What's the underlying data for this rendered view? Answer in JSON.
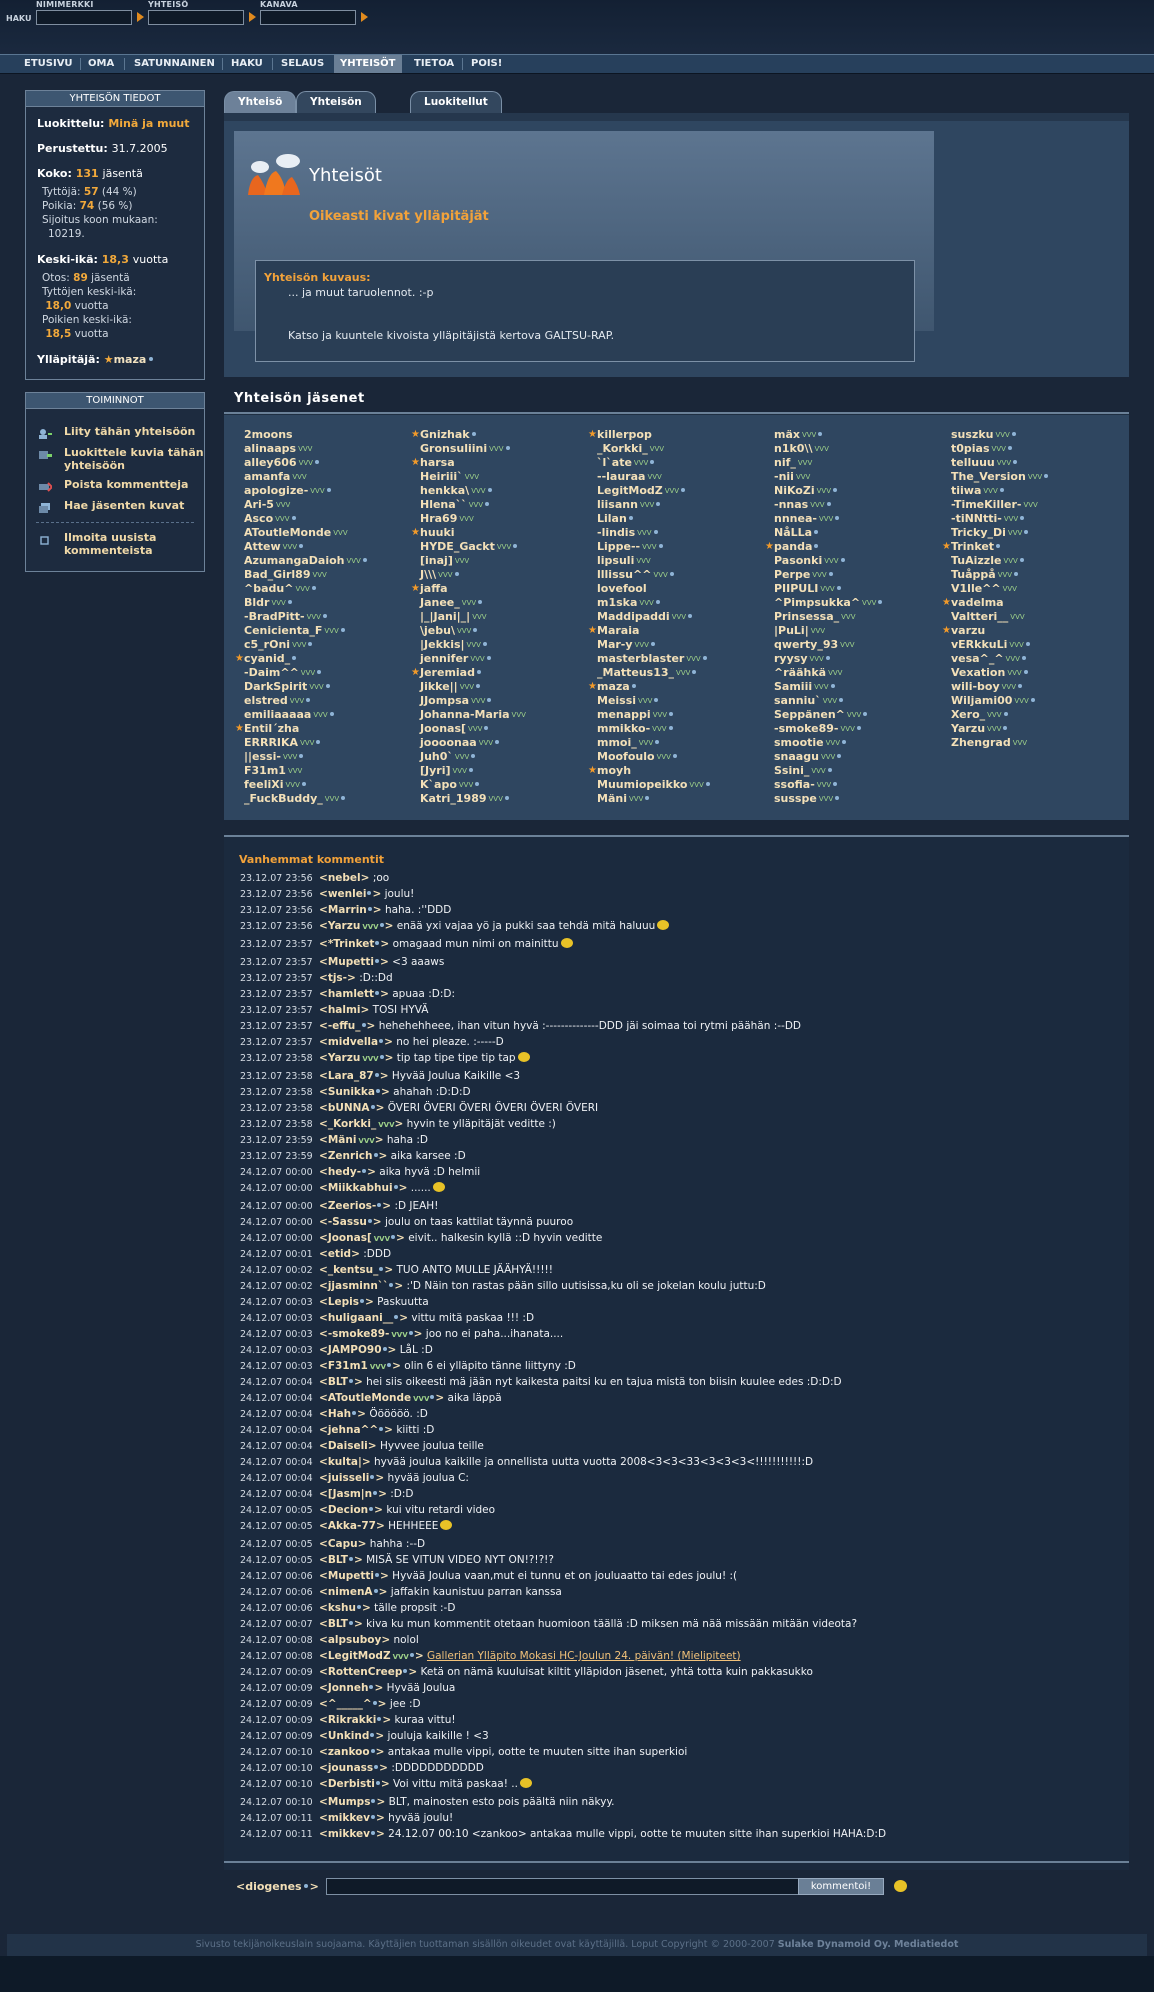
{
  "search": {
    "haku_label": "HAKU",
    "fields": [
      {
        "label": "NIMIMERKKI",
        "value": ""
      },
      {
        "label": "YHTEISÖ",
        "value": ""
      },
      {
        "label": "KANAVA",
        "value": ""
      }
    ]
  },
  "nav": {
    "items": [
      "ETUSIVU",
      "OMA",
      "SATUNNAINEN",
      "HAKU",
      "SELAUS",
      "YHTEISÖT",
      "TIETOA",
      "POIS!"
    ],
    "active": "YHTEISÖT"
  },
  "info": {
    "title": "YHTEISÖN TIEDOT",
    "category_label": "Luokittelu:",
    "category": "Minä ja muut",
    "founded_label": "Perustettu:",
    "founded": "31.7.2005",
    "size_label": "Koko:",
    "size": "131",
    "size_unit": "jäsentä",
    "girls_label": "Tyttöjä:",
    "girls": "57",
    "girls_pct": "(44 %)",
    "boys_label": "Poikia:",
    "boys": "74",
    "boys_pct": "(56 %)",
    "rank_label": "Sijoitus koon mukaan:",
    "rank": "10219.",
    "age_label": "Keski-ikä:",
    "age": "18,3",
    "age_unit": "vuotta",
    "sample_label": "Otos:",
    "sample": "89",
    "sample_unit": "jäsentä",
    "gavg_label": "Tyttöjen keski-ikä:",
    "gavg": "18,0",
    "gavg_unit": "vuotta",
    "bavg_label": "Poikien keski-ikä:",
    "bavg": "18,5",
    "bavg_unit": "vuotta",
    "admin_label": "Ylläpitäjä:",
    "admin": "maza"
  },
  "actions": {
    "title": "TOIMINNOT",
    "items": [
      {
        "label": "Liity tähän yhteisöön",
        "icon": "join-icon"
      },
      {
        "label": "Luokittele kuvia tähän yhteisöön",
        "icon": "categorize-icon"
      },
      {
        "label": "Poista kommentteja",
        "icon": "delete-comments-icon"
      },
      {
        "label": "Hae jäsenten kuvat",
        "icon": "member-photos-icon"
      },
      {
        "label": "Ilmoita uusista kommenteista",
        "icon": "notify-icon"
      }
    ]
  },
  "tabs": [
    "Yhteisö",
    "Yhteisön kuvat",
    "Luokitellut kuvat"
  ],
  "community": {
    "header": "Yhteisöt",
    "name": "Oikeasti kivat ylläpitäjät",
    "desc_title": "Yhteisön kuvaus:",
    "desc_line1": "... ja muut taruolennot. :-p",
    "desc_line2": "Katso ja kuuntele kivoista ylläpitäjistä kertova GALTSU-RAP."
  },
  "members_title": "Yhteisön jäsenet",
  "members": [
    [
      [
        "2moons",
        0,
        0,
        0
      ],
      [
        "alinaaps",
        0,
        1,
        0
      ],
      [
        "alley606",
        0,
        1,
        1
      ],
      [
        "amanfa",
        0,
        1,
        0
      ],
      [
        "apologize-",
        0,
        1,
        1
      ],
      [
        "Ari-5",
        0,
        1,
        0
      ],
      [
        "Asco",
        0,
        1,
        1
      ],
      [
        "AToutleMonde",
        0,
        1,
        0
      ],
      [
        "Attew",
        0,
        1,
        1
      ],
      [
        "AzumangaDaioh",
        0,
        1,
        1
      ],
      [
        "Bad_Girl89",
        0,
        1,
        0
      ],
      [
        "^badu^",
        0,
        1,
        1
      ],
      [
        "Bldr",
        0,
        1,
        1
      ],
      [
        "-BradPitt-",
        0,
        1,
        1
      ],
      [
        "Cenicienta_F",
        0,
        1,
        1
      ],
      [
        "c5_rOni",
        0,
        1,
        1
      ],
      [
        "cyanid_",
        1,
        0,
        1
      ],
      [
        "-Daim^^",
        0,
        1,
        1
      ],
      [
        "DarkSpirit",
        0,
        1,
        1
      ],
      [
        "elstred",
        0,
        1,
        1
      ],
      [
        "emiliaaaaa",
        0,
        1,
        1
      ],
      [
        "Entil´zha",
        1,
        0,
        0
      ],
      [
        "ERRRIKA",
        0,
        1,
        1
      ],
      [
        "||essi-",
        0,
        1,
        1
      ],
      [
        "F31m1",
        0,
        1,
        0
      ],
      [
        "feeliXi",
        0,
        1,
        1
      ],
      [
        "_FuckBuddy_",
        0,
        1,
        1
      ]
    ],
    [
      [
        "Gnizhak",
        1,
        0,
        1
      ],
      [
        "Gronsuliini",
        0,
        1,
        1
      ],
      [
        "harsa",
        1,
        0,
        0
      ],
      [
        "Heiriii`",
        0,
        1,
        0
      ],
      [
        "henkka\\",
        0,
        1,
        1
      ],
      [
        "Hlena``",
        0,
        1,
        1
      ],
      [
        "Hra69",
        0,
        1,
        0
      ],
      [
        "huuki",
        1,
        0,
        0
      ],
      [
        "HYDE_Gackt",
        0,
        1,
        1
      ],
      [
        "[inaj]",
        0,
        1,
        0
      ],
      [
        "J\\\\\\",
        0,
        1,
        1
      ],
      [
        "jaffa",
        1,
        0,
        0
      ],
      [
        "Janee_",
        0,
        1,
        1
      ],
      [
        "|_|Jani|_|",
        0,
        1,
        0
      ],
      [
        "\\jebu\\",
        0,
        1,
        1
      ],
      [
        "|Jekkis|",
        0,
        1,
        1
      ],
      [
        "jennifer",
        0,
        1,
        1
      ],
      [
        "Jeremiad",
        1,
        0,
        1
      ],
      [
        "Jikke||",
        0,
        1,
        1
      ],
      [
        "JJompsa",
        0,
        1,
        1
      ],
      [
        "Johanna-Maria",
        0,
        1,
        0
      ],
      [
        "Joonas[",
        0,
        1,
        1
      ],
      [
        "joooonaa",
        0,
        1,
        1
      ],
      [
        "Juh0`",
        0,
        1,
        1
      ],
      [
        "[Jyri]",
        0,
        1,
        1
      ],
      [
        "K`apo",
        0,
        1,
        1
      ],
      [
        "Katri_1989",
        0,
        1,
        1
      ]
    ],
    [
      [
        "killerpop",
        1,
        0,
        0
      ],
      [
        "_Korkki_",
        0,
        1,
        0
      ],
      [
        "`l`ate",
        0,
        1,
        1
      ],
      [
        "--lauraa",
        0,
        1,
        0
      ],
      [
        "LegitModZ",
        0,
        1,
        1
      ],
      [
        "liisann",
        0,
        1,
        1
      ],
      [
        "Lilan",
        0,
        0,
        1
      ],
      [
        "-lindis",
        0,
        1,
        1
      ],
      [
        "Lippe--",
        0,
        1,
        1
      ],
      [
        "lipsuli",
        0,
        1,
        0
      ],
      [
        "lllissu^^",
        0,
        1,
        1
      ],
      [
        "lovefool",
        0,
        0,
        0
      ],
      [
        "m1ska",
        0,
        1,
        1
      ],
      [
        "Maddipaddi",
        0,
        1,
        1
      ],
      [
        "Maraia",
        1,
        0,
        0
      ],
      [
        "Mar-y",
        0,
        1,
        1
      ],
      [
        "masterblaster",
        0,
        1,
        1
      ],
      [
        "_Matteus13_",
        0,
        1,
        1
      ],
      [
        "maza",
        1,
        0,
        1
      ],
      [
        "Meissi",
        0,
        1,
        1
      ],
      [
        "menappi",
        0,
        1,
        1
      ],
      [
        "mmikko-",
        0,
        1,
        1
      ],
      [
        "mmoi_",
        0,
        1,
        1
      ],
      [
        "Moofoulo",
        0,
        1,
        1
      ],
      [
        "moyh",
        1,
        0,
        0
      ],
      [
        "Muumiopeikko",
        0,
        1,
        1
      ],
      [
        "Mäni",
        0,
        1,
        1
      ]
    ],
    [
      [
        "mäx",
        0,
        1,
        1
      ],
      [
        "n1k0\\\\",
        0,
        1,
        0
      ],
      [
        "nif_",
        0,
        1,
        0
      ],
      [
        "-nii",
        0,
        1,
        0
      ],
      [
        "NiKoZi",
        0,
        1,
        1
      ],
      [
        "-nnas",
        0,
        1,
        1
      ],
      [
        "nnnea-",
        0,
        1,
        1
      ],
      [
        "NåLLa",
        0,
        0,
        1
      ],
      [
        "panda",
        1,
        0,
        1
      ],
      [
        "Pasonki",
        0,
        1,
        1
      ],
      [
        "Perpe",
        0,
        1,
        1
      ],
      [
        "PIIPULI",
        0,
        1,
        1
      ],
      [
        "^Pimpsukka^",
        0,
        1,
        1
      ],
      [
        "Prinsessa_",
        0,
        1,
        0
      ],
      [
        "|PuLi|",
        0,
        1,
        0
      ],
      [
        "qwerty_93",
        0,
        1,
        0
      ],
      [
        "ryysy",
        0,
        1,
        1
      ],
      [
        "^räähkä",
        0,
        1,
        0
      ],
      [
        "Samiii",
        0,
        1,
        1
      ],
      [
        "sanniu`",
        0,
        1,
        1
      ],
      [
        "Seppänen^",
        0,
        1,
        1
      ],
      [
        "-smoke89-",
        0,
        1,
        1
      ],
      [
        "smootie",
        0,
        1,
        1
      ],
      [
        "snaagu",
        0,
        1,
        1
      ],
      [
        "Ssini_",
        0,
        1,
        1
      ],
      [
        "ssofia-",
        0,
        1,
        1
      ],
      [
        "susspe",
        0,
        1,
        1
      ]
    ],
    [
      [
        "suszku",
        0,
        1,
        1
      ],
      [
        "t0pias",
        0,
        1,
        1
      ],
      [
        "telluuu",
        0,
        1,
        1
      ],
      [
        "The_Version",
        0,
        1,
        1
      ],
      [
        "tiiwa",
        0,
        1,
        1
      ],
      [
        "-TimeKiller-",
        0,
        1,
        0
      ],
      [
        "-tiNNtti-",
        0,
        1,
        1
      ],
      [
        "Tricky_Di",
        0,
        1,
        1
      ],
      [
        "Trinket",
        1,
        0,
        1
      ],
      [
        "TuAizzle",
        0,
        1,
        1
      ],
      [
        "Tuåppå",
        0,
        1,
        1
      ],
      [
        "V1lle^^",
        0,
        1,
        0
      ],
      [
        "vadelma",
        1,
        0,
        0
      ],
      [
        "Valtteri__",
        0,
        1,
        0
      ],
      [
        "varzu",
        1,
        0,
        0
      ],
      [
        "vERkkuLi",
        0,
        1,
        1
      ],
      [
        "vesa^_^",
        0,
        1,
        1
      ],
      [
        "Vexation",
        0,
        1,
        1
      ],
      [
        "wili-boy",
        0,
        1,
        1
      ],
      [
        "Wiljami00",
        0,
        1,
        1
      ],
      [
        "Xero_",
        0,
        1,
        1
      ],
      [
        "Yarzu",
        0,
        1,
        1
      ],
      [
        "Zhengrad",
        0,
        1,
        0
      ]
    ]
  ],
  "comments_title": "Vanhemmat kommentit",
  "comments": [
    [
      "23.12.07 23:56",
      "nebel",
      0,
      0,
      ";oo",
      0
    ],
    [
      "23.12.07 23:56",
      "wenlei",
      0,
      1,
      "joulu!",
      0
    ],
    [
      "23.12.07 23:56",
      "Marrin",
      0,
      1,
      "haha. :''DDD",
      0
    ],
    [
      "23.12.07 23:56",
      "Yarzu",
      1,
      1,
      "enää yxi vajaa yö ja pukki saa tehdä mitä haluuu",
      1
    ],
    [
      "23.12.07 23:57",
      "*Trinket",
      0,
      1,
      "omagaad mun nimi on mainittu",
      1
    ],
    [
      "23.12.07 23:57",
      "Mupetti",
      0,
      1,
      "<3 aaaws",
      0
    ],
    [
      "23.12.07 23:57",
      "tjs-",
      0,
      0,
      ":D::Dd",
      0
    ],
    [
      "23.12.07 23:57",
      "hamlett",
      0,
      1,
      "apuaa :D:D:",
      0
    ],
    [
      "23.12.07 23:57",
      "halmi",
      0,
      0,
      "TOSI HYVÄ",
      0
    ],
    [
      "23.12.07 23:57",
      "-effu_",
      0,
      1,
      "hehehehheee, ihan vitun hyvä :--------------DDD jäi soimaa toi rytmi päähän :--DD",
      0
    ],
    [
      "23.12.07 23:57",
      "midvella",
      0,
      1,
      "no hei pleaze. :-----D",
      0
    ],
    [
      "23.12.07 23:58",
      "Yarzu",
      1,
      1,
      "tip tap tipe tipe tip tap",
      1
    ],
    [
      "23.12.07 23:58",
      "Lara_87",
      0,
      1,
      "Hyvää Joulua Kaikille <3",
      0
    ],
    [
      "23.12.07 23:58",
      "Sunikka",
      0,
      1,
      "ahahah :D:D:D",
      0
    ],
    [
      "23.12.07 23:58",
      "bUNNA",
      0,
      1,
      "ÖVERI ÖVERI ÖVERI ÖVERI ÖVERI ÖVERI",
      0
    ],
    [
      "23.12.07 23:58",
      "_Korkki_",
      1,
      0,
      "hyvin te ylläpitäjät veditte :)",
      0
    ],
    [
      "23.12.07 23:59",
      "Mäni",
      1,
      0,
      "haha :D",
      0
    ],
    [
      "23.12.07 23:59",
      "Zenrich",
      0,
      1,
      "aika karsee :D",
      0
    ],
    [
      "24.12.07 00:00",
      "hedy-",
      0,
      1,
      "aika hyvä :D helmii",
      0
    ],
    [
      "24.12.07 00:00",
      "Miikkabhui",
      0,
      1,
      "......",
      1
    ],
    [
      "24.12.07 00:00",
      "Zeerios-",
      0,
      1,
      ":D JEAH!",
      0
    ],
    [
      "24.12.07 00:00",
      "-Sassu",
      0,
      1,
      "joulu on taas kattilat täynnä puuroo",
      0
    ],
    [
      "24.12.07 00:00",
      "Joonas[",
      1,
      1,
      "eivit.. halkesin kyllä ::D hyvin veditte",
      0
    ],
    [
      "24.12.07 00:01",
      "etid",
      0,
      0,
      ":DDD",
      0
    ],
    [
      "24.12.07 00:02",
      "_kentsu_",
      0,
      1,
      "TUO ANTO MULLE JÄÄHYÄ!!!!!",
      0
    ],
    [
      "24.12.07 00:02",
      "jjasminn``",
      0,
      1,
      ":'D Näin ton rastas pään sillo uutisissa,ku oli se jokelan koulu juttu:D",
      0
    ],
    [
      "24.12.07 00:03",
      "Lepis",
      0,
      1,
      "Paskuutta",
      0
    ],
    [
      "24.12.07 00:03",
      "huligaani__",
      0,
      1,
      "vittu mitä paskaa !!! :D",
      0
    ],
    [
      "24.12.07 00:03",
      "-smoke89-",
      1,
      1,
      "joo no ei paha...ihanata....",
      0
    ],
    [
      "24.12.07 00:03",
      "JAMPO90",
      0,
      1,
      "LåL :D",
      0
    ],
    [
      "24.12.07 00:03",
      "F31m1",
      1,
      1,
      "olin 6 ei ylläpito tänne liittyny :D",
      0
    ],
    [
      "24.12.07 00:04",
      "BLT",
      0,
      1,
      "hei siis oikeesti mä jään nyt kaikesta paitsi ku en tajua mistä ton biisin kuulee edes :D:D:D",
      0
    ],
    [
      "24.12.07 00:04",
      "AToutleMonde",
      1,
      1,
      "aika läppä",
      0
    ],
    [
      "24.12.07 00:04",
      "Hah",
      0,
      1,
      "Öööööö. :D",
      0
    ],
    [
      "24.12.07 00:04",
      "jehna^^",
      0,
      1,
      "kiitti :D",
      0
    ],
    [
      "24.12.07 00:04",
      "Daiseli",
      0,
      0,
      "Hyvvee joulua teille",
      0
    ],
    [
      "24.12.07 00:04",
      "kulta|",
      0,
      0,
      "hyvää joulua kaikille ja onnellista uutta vuotta 2008<3<3<33<3<3<3<!!!!!!!!!!!:D",
      0
    ],
    [
      "24.12.07 00:04",
      "juisseli",
      0,
      1,
      "hyvää joulua C:",
      0
    ],
    [
      "24.12.07 00:04",
      "[Jasm|n",
      0,
      1,
      ":D:D",
      0
    ],
    [
      "24.12.07 00:05",
      "Decion",
      0,
      1,
      "kui vitu retardi video",
      0
    ],
    [
      "24.12.07 00:05",
      "Akka-77",
      0,
      0,
      "HEHHEEE",
      1
    ],
    [
      "24.12.07 00:05",
      "Capu",
      0,
      0,
      "hahha :--D",
      0
    ],
    [
      "24.12.07 00:05",
      "BLT",
      0,
      1,
      "MISÄ SE VITUN VIDEO NYT ON!?!?!?",
      0
    ],
    [
      "24.12.07 00:06",
      "Mupetti",
      0,
      1,
      "Hyvää Joulua vaan,mut ei tunnu et on jouluaatto tai edes joulu! :(",
      0
    ],
    [
      "24.12.07 00:06",
      "nimenA",
      0,
      1,
      "jaffakin kaunistuu parran kanssa",
      0
    ],
    [
      "24.12.07 00:06",
      "kshu",
      0,
      1,
      "tälle propsit :-D",
      0
    ],
    [
      "24.12.07 00:07",
      "BLT",
      0,
      1,
      "kiva ku mun kommentit otetaan huomioon täällä :D miksen mä nää missään mitään videota?",
      0
    ],
    [
      "24.12.07 00:08",
      "alpsuboy",
      0,
      0,
      "nolol",
      0
    ],
    [
      "24.12.07 00:08",
      "LegitModZ",
      1,
      1,
      "Gallerian Ylläpito Mokasi HC-Joulun 24. päivän! (Mielipiteet)",
      2
    ],
    [
      "24.12.07 00:09",
      "RottenCreep",
      0,
      1,
      "Ketä on nämä kuuluisat kiltit ylläpidon jäsenet, yhtä totta kuin pakkasukko",
      0
    ],
    [
      "24.12.07 00:09",
      "Jonneh",
      0,
      1,
      "Hyvää Joulua",
      0
    ],
    [
      "24.12.07 00:09",
      "^_____^",
      0,
      1,
      "jee :D",
      0
    ],
    [
      "24.12.07 00:09",
      "Rikrakki",
      0,
      1,
      "kuraa vittu!",
      0
    ],
    [
      "24.12.07 00:09",
      "Unkind",
      0,
      1,
      "jouluja kaikille ! <3",
      0
    ],
    [
      "24.12.07 00:10",
      "zankoo",
      0,
      1,
      "antakaa mulle vippi, ootte te muuten sitte ihan superkioi",
      0
    ],
    [
      "24.12.07 00:10",
      "jounass",
      0,
      1,
      ":DDDDDDDDDDD",
      0
    ],
    [
      "24.12.07 00:10",
      "Derbisti",
      0,
      1,
      "Voi vittu mitä paskaa! ..",
      1
    ],
    [
      "24.12.07 00:10",
      "Mumps",
      0,
      1,
      "BLT, mainosten esto pois päältä niin näkyy.",
      0
    ],
    [
      "24.12.07 00:11",
      "mikkev",
      0,
      1,
      "hyvää joulu!",
      0
    ],
    [
      "24.12.07 00:11",
      "mikkev",
      0,
      1,
      "24.12.07 00:10 <zankoo> antakaa mulle vippi, ootte te muuten sitte ihan superkioi HAHA:D:D",
      0
    ]
  ],
  "input": {
    "nick": "diogenes",
    "button": "kommentoi!"
  },
  "footer": {
    "text": "Sivusto tekijänoikeuslain suojaama. Käyttäjien tuottaman sisällön oikeudet ovat käyttäjillä. Loput Copyright © 2000-2007",
    "company": "Sulake Dynamoid Oy.",
    "link": "Mediatiedot"
  }
}
